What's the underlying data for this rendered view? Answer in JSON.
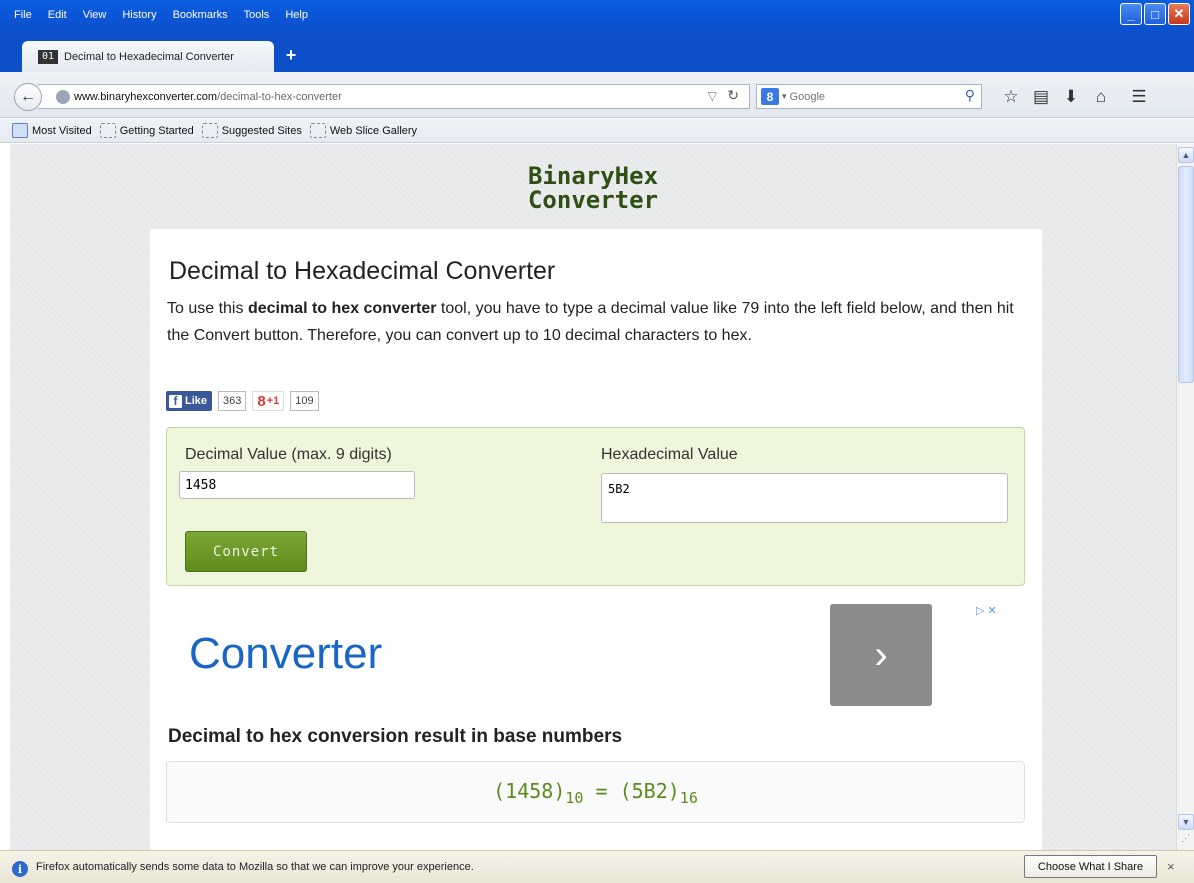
{
  "window": {
    "menu": [
      "File",
      "Edit",
      "View",
      "History",
      "Bookmarks",
      "Tools",
      "Help"
    ],
    "controls": {
      "minimize": "_",
      "maximize": "□",
      "close": "✕"
    }
  },
  "tab": {
    "favicon_text": "01",
    "title": "Decimal to Hexadecimal Converter",
    "new_tab": "+"
  },
  "navbar": {
    "url_host": "www.binaryhexconverter.com",
    "url_path": "/decimal-to-hex-converter",
    "search_placeholder": "Google",
    "search_engine_icon": "8"
  },
  "bookmarks": [
    "Most Visited",
    "Getting Started",
    "Suggested Sites",
    "Web Slice Gallery"
  ],
  "page": {
    "logo_line1": "BinaryHex",
    "logo_line2": "Converter",
    "title": "Decimal to Hexadecimal Converter",
    "intro_pre": "To use this ",
    "intro_bold": "decimal to hex converter",
    "intro_post": " tool, you have to type a decimal value like 79 into the left field below, and then hit the Convert button. Therefore, you can convert up to 10 decimal characters to hex.",
    "social": {
      "fb_label": "Like",
      "fb_count": "363",
      "gplus_label": "+1",
      "gplus_count": "109"
    },
    "converter": {
      "decimal_label": "Decimal Value (max. 9 digits)",
      "decimal_value": "1458",
      "hex_label": "Hexadecimal Value",
      "hex_value": "5B2",
      "convert_label": "Convert"
    },
    "ad": {
      "text": "Converter",
      "arrow": "›"
    },
    "result": {
      "heading": "Decimal to hex conversion result in base numbers",
      "decimal": "1458",
      "decimal_base": "10",
      "hex": "5B2",
      "hex_base": "16"
    }
  },
  "notification": {
    "text": "Firefox automatically sends some data to Mozilla so that we can improve your experience.",
    "button": "Choose What I Share",
    "close": "×"
  }
}
